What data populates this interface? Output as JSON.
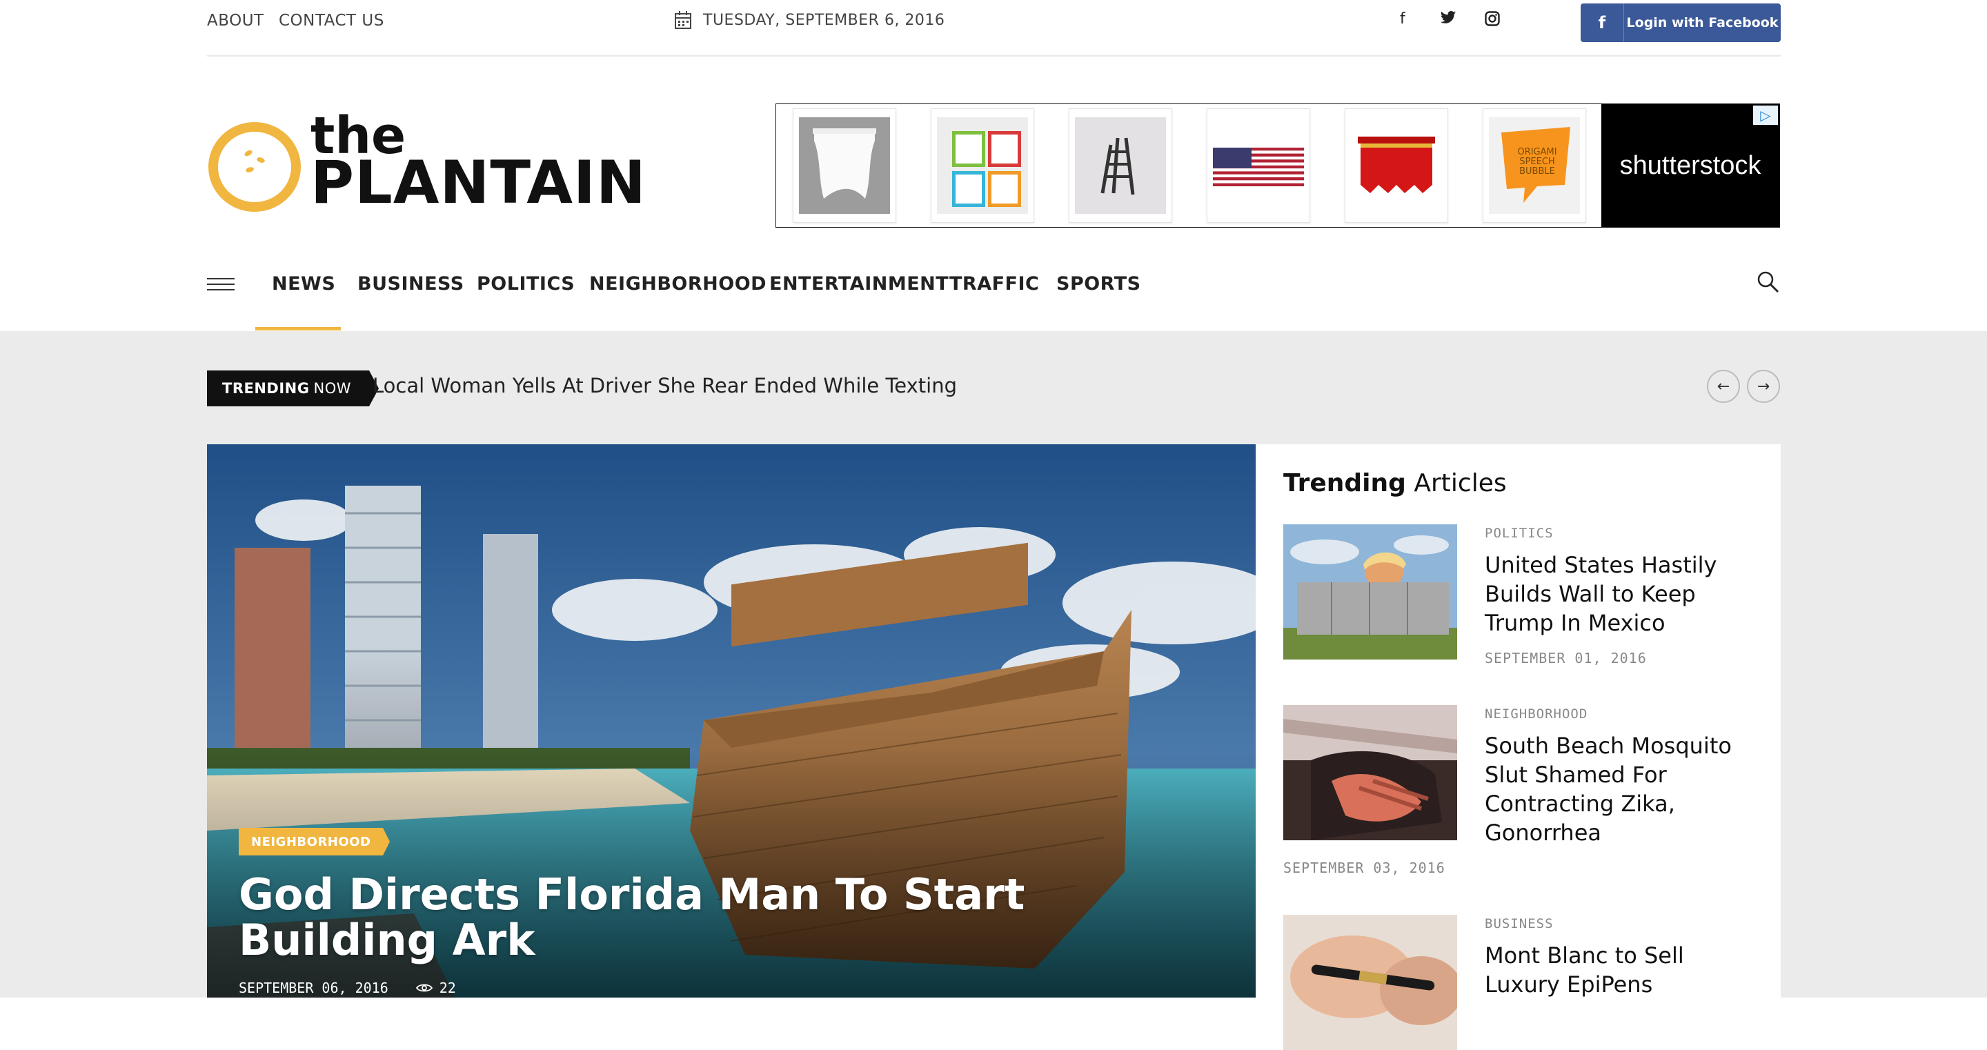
{
  "topbar": {
    "links": [
      "ABOUT",
      "CONTACT US"
    ],
    "date": "TUESDAY, SEPTEMBER 6, 2016",
    "social_icons": [
      "facebook-icon",
      "twitter-icon",
      "instagram-icon"
    ],
    "login_button": "Login with Facebook"
  },
  "logo": {
    "line1": "the",
    "line2": "PLANTAIN"
  },
  "ad": {
    "brand": "shutterstock",
    "origami_text": "ORIGAMI SPEECH BUBBLE"
  },
  "nav": {
    "items": [
      "NEWS",
      "BUSINESS",
      "POLITICS",
      "NEIGHBORHOOD",
      "ENTERTAINMENT",
      "TRAFFIC",
      "SPORTS"
    ],
    "active": "NEWS"
  },
  "trending_bar": {
    "label_bold": "TRENDING",
    "label_rest": "NOW",
    "headline": "Local Woman Yells At Driver She Rear Ended While Texting",
    "prev": "←",
    "next": "→"
  },
  "hero": {
    "category": "NEIGHBORHOOD",
    "title": "God Directs Florida Man To Start Building Ark",
    "date": "SEPTEMBER 06, 2016",
    "views": "22"
  },
  "sidebar": {
    "heading_bold": "Trending",
    "heading_rest": "Articles",
    "articles": [
      {
        "category": "POLITICS",
        "title": "United States Hastily Builds Wall to Keep Trump In Mexico",
        "date": "SEPTEMBER 01, 2016"
      },
      {
        "category": "NEIGHBORHOOD",
        "title": "South Beach Mosquito Slut Shamed For Contracting Zika, Gonorrhea",
        "date": "SEPTEMBER 03, 2016"
      },
      {
        "category": "BUSINESS",
        "title": "Mont Blanc to Sell Luxury EpiPens",
        "date": ""
      }
    ]
  },
  "colors": {
    "accent": "#f0b640",
    "facebook": "#3b5998",
    "gray_bg": "#ebebeb"
  }
}
